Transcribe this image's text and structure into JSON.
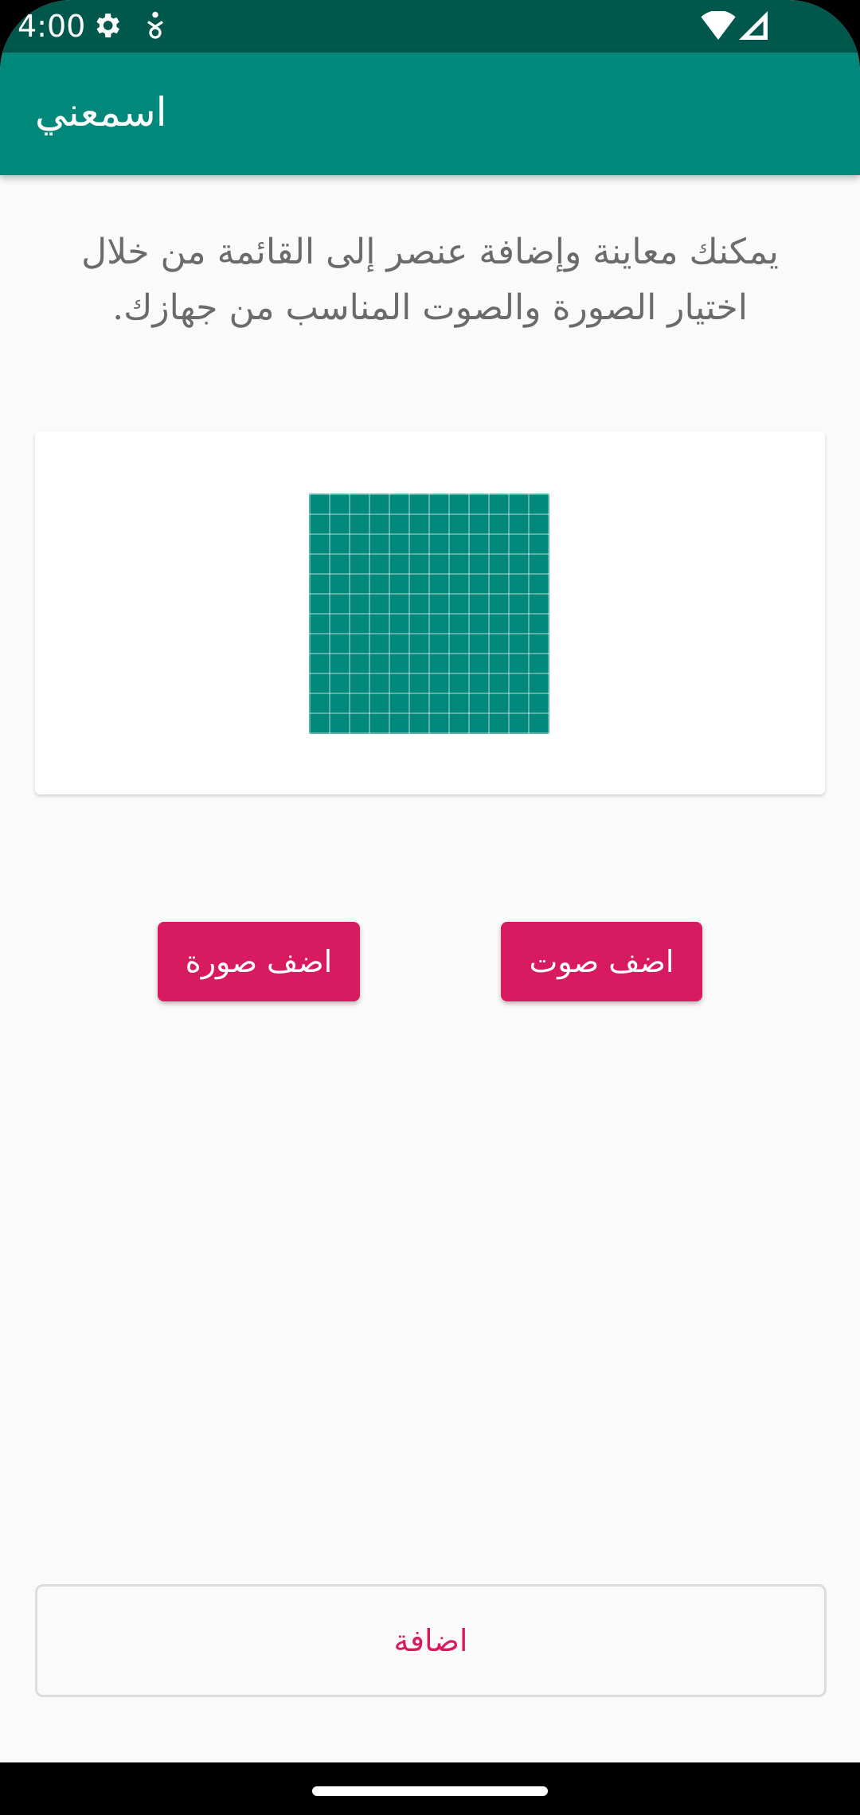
{
  "status_bar": {
    "time": "4:00",
    "icons": [
      "gear-icon",
      "accessibility-icon",
      "wifi-icon",
      "signal-icon"
    ]
  },
  "app_bar": {
    "title": "اسمعني",
    "color": "#00897b"
  },
  "description": "يمكنك معاينة وإضافة عنصر إلى القائمة من خلال اختيار الصورة والصوت المناسب من جهازك.",
  "preview": {
    "image_icon": "grid-placeholder-image"
  },
  "buttons": {
    "add_image": "اضف صورة",
    "add_audio": "اضف صوت",
    "accent_color": "#d81b60"
  },
  "submit": {
    "label": "اضافة"
  }
}
